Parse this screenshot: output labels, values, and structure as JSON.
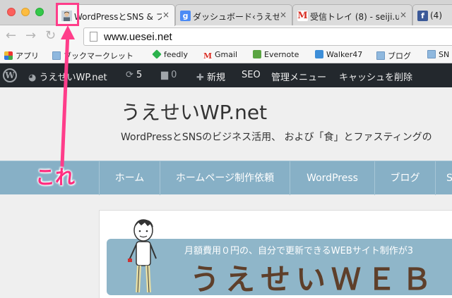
{
  "browser": {
    "tabs": [
      {
        "title": "WordPressとSNS & ファ",
        "favicon": "avatar-icon",
        "active": true
      },
      {
        "title": "ダッシュボード‹うえせ",
        "favicon": "google-icon",
        "favicon_text": "g",
        "active": false
      },
      {
        "title": "受信トレイ (8) - seiji.u",
        "favicon": "gmail-icon",
        "favicon_text": "M",
        "active": false
      },
      {
        "title": "(4)",
        "favicon": "facebook-icon",
        "favicon_text": "f",
        "active": false
      }
    ],
    "tab_close": "×",
    "nav": {
      "back": "←",
      "forward": "→",
      "reload": "↻"
    },
    "url": "www.uesei.net",
    "bookmarks": [
      {
        "label": "アプリ",
        "icon": "apps-icon"
      },
      {
        "label": "ブックマークレット",
        "icon": "folder-icon"
      },
      {
        "label": "feedly",
        "icon": "feedly-icon"
      },
      {
        "label": "Gmail",
        "icon": "gmail-icon",
        "icon_text": "M"
      },
      {
        "label": "Evernote",
        "icon": "evernote-icon"
      },
      {
        "label": "Walker47",
        "icon": "walker-icon"
      },
      {
        "label": "ブログ",
        "icon": "folder-icon"
      },
      {
        "label": "SN",
        "icon": "folder-icon"
      }
    ]
  },
  "adminbar": {
    "site_name": "うえせいWP.net",
    "updates_count": "5",
    "comments_count": "0",
    "new_label": "新規",
    "seo_label": "SEO",
    "admin_menu_label": "管理メニュー",
    "cache_label": "キャッシュを削除"
  },
  "site": {
    "title": "うえせいWP.net",
    "description": "WordPressとSNSのビジネス活用、 および「食」とファスティングの",
    "nav": [
      "ホーム",
      "ホームページ制作依頼",
      "WordPress",
      "ブログ",
      "S"
    ],
    "banner": {
      "subtitle": "月額費用０円の、自分で更新できるWEBサイト制作が3",
      "headline": "うえせいＷＥＢ"
    }
  },
  "annotation": {
    "label": "これ",
    "color": "#ff2d7f"
  },
  "colors": {
    "adminbar_bg": "#23282d",
    "nav_bg": "#87b0c6",
    "annotation": "#ff3d8a"
  }
}
